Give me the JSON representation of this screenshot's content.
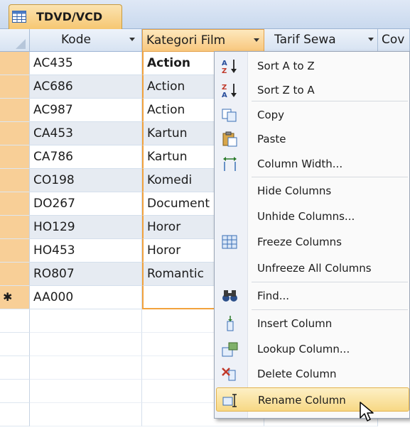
{
  "tab": {
    "label": "TDVD/VCD"
  },
  "columns": [
    {
      "label": "Kode",
      "dropdown": true
    },
    {
      "label": "Kategori Film",
      "dropdown": true
    },
    {
      "label": "Tarif Sewa",
      "dropdown": true
    },
    {
      "label": "Cov",
      "dropdown": false
    }
  ],
  "rows": [
    {
      "kode": "AC435",
      "kategori": "Action"
    },
    {
      "kode": "AC686",
      "kategori": "Action"
    },
    {
      "kode": "AC987",
      "kategori": "Action"
    },
    {
      "kode": "CA453",
      "kategori": "Kartun"
    },
    {
      "kode": "CA786",
      "kategori": "Kartun"
    },
    {
      "kode": "CO198",
      "kategori": "Komedi"
    },
    {
      "kode": "DO267",
      "kategori": "Document"
    },
    {
      "kode": "HO129",
      "kategori": "Horor"
    },
    {
      "kode": "HO453",
      "kategori": "Horor"
    },
    {
      "kode": "RO807",
      "kategori": "Romantic"
    }
  ],
  "new_row": {
    "marker": "✱",
    "kode": "AA000",
    "kategori": ""
  },
  "context_menu": {
    "items": [
      {
        "label": "Sort A to Z",
        "icon": "sort-a-z-icon"
      },
      {
        "label": "Sort Z to A",
        "icon": "sort-z-a-icon"
      },
      {
        "label": "Copy",
        "icon": "copy-icon"
      },
      {
        "label": "Paste",
        "icon": "paste-icon"
      },
      {
        "label": "Column Width...",
        "icon": "column-width-icon"
      },
      {
        "label": "Hide Columns",
        "icon": ""
      },
      {
        "label": "Unhide Columns...",
        "icon": ""
      },
      {
        "label": "Freeze Columns",
        "icon": "freeze-columns-icon"
      },
      {
        "label": "Unfreeze All Columns",
        "icon": ""
      },
      {
        "label": "Find...",
        "icon": "find-binoculars-icon"
      },
      {
        "label": "Insert Column",
        "icon": "insert-column-icon"
      },
      {
        "label": "Lookup Column...",
        "icon": "lookup-column-icon"
      },
      {
        "label": "Delete Column",
        "icon": "delete-column-icon"
      },
      {
        "label": "Rename Column",
        "icon": "rename-column-icon"
      }
    ],
    "highlighted_item": "Rename Column"
  },
  "colors": {
    "selected_column_border": "#f2a23d",
    "row_selector": "#f8cf97",
    "menu_highlight": "#f7d884",
    "alt_row": "#e6ebf2"
  }
}
